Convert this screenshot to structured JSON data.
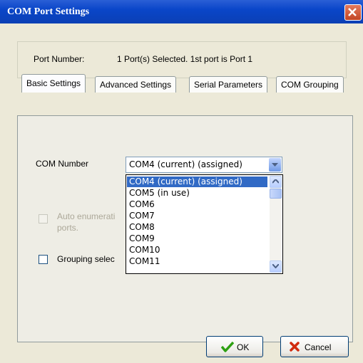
{
  "window": {
    "title": "COM Port Settings"
  },
  "port": {
    "label": "Port Number:",
    "value": "1 Port(s) Selected. 1st port is Port 1"
  },
  "tabs": [
    {
      "label": "Basic Settings"
    },
    {
      "label": "Advanced Settings"
    },
    {
      "label": "Serial Parameters"
    },
    {
      "label": "COM Grouping"
    }
  ],
  "basic": {
    "com_number_label": "COM Number",
    "com_number_value": "COM4 (current) (assigned)",
    "options": [
      "COM4 (current) (assigned)",
      "COM5 (in use)",
      "COM6",
      "COM7",
      "COM8",
      "COM9",
      "COM10",
      "COM11"
    ],
    "auto_enum_line1": "Auto enumerati",
    "auto_enum_line2": "ports.",
    "grouping_label": "Grouping selec"
  },
  "buttons": {
    "ok": "OK",
    "cancel": "Cancel"
  },
  "colors": {
    "titlebar": "#0a46c9",
    "selection": "#316ac5",
    "face": "#ece9d8"
  }
}
